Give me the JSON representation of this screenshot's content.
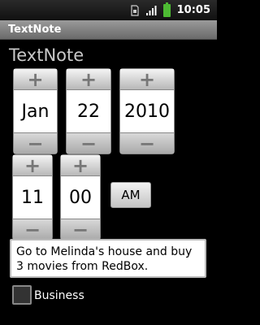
{
  "status_bar": {
    "time": "10:05",
    "icons": [
      "sim-icon",
      "signal-icon",
      "battery-icon"
    ]
  },
  "app": {
    "title": "TextNote",
    "heading": "TextNote"
  },
  "date_pickers": {
    "month": "Jan",
    "day": "22",
    "year": "2010"
  },
  "time_pickers": {
    "hour": "11",
    "minute": "00",
    "ampm": "AM"
  },
  "picker_glyphs": {
    "plus": "+",
    "minus": "−"
  },
  "note": {
    "text": "Go to Melinda's house and buy 3 movies from RedBox."
  },
  "category": {
    "label": "Business",
    "checked": false
  },
  "colors": {
    "background": "#000000",
    "titlebar": "#8a8a8a",
    "battery": "#4dbb33"
  }
}
